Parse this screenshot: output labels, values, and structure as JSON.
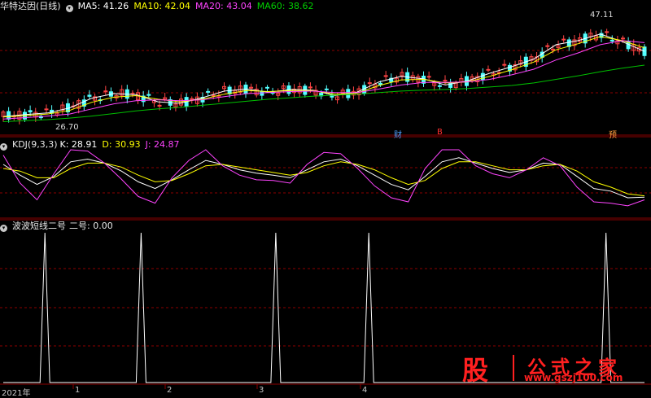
{
  "main_header": {
    "title": "华特达因(日线)",
    "ma5": "MA5: 41.26",
    "ma10": "MA10: 42.04",
    "ma20": "MA20: 43.04",
    "ma60": "MA60: 38.62"
  },
  "kdj_header": {
    "title": "KDJ(9,3,3)",
    "k": "K: 28.91",
    "d": "D: 30.93",
    "j": "J: 24.87"
  },
  "ind_header": {
    "title": "波波短线二号",
    "value": "二号: 0.00"
  },
  "price_labels": {
    "high": "47.11",
    "low": "26.70"
  },
  "event_marks": [
    "财",
    "B",
    "预"
  ],
  "x_labels": [
    "2021年",
    "1",
    "2",
    "3",
    "4"
  ],
  "logo": {
    "char": "股",
    "text": "公式之家",
    "url": "www.gszj100.com"
  },
  "colors": {
    "up": "#ff4444",
    "down": "#54ffff",
    "ma5": "#ffffff",
    "ma10": "#ffff00",
    "ma20": "#ff44ff",
    "ma60": "#00c000",
    "k": "#ffffff",
    "d": "#ffff00",
    "j": "#ff44ff",
    "grid": "#8b0000",
    "signal": "#ffffff"
  },
  "chart_data": [
    {
      "type": "line",
      "title": "华特达因(日线)",
      "note_series": [
        "MA5",
        "MA10",
        "MA20",
        "MA60"
      ],
      "series": [
        {
          "name": "MA5",
          "values": [
            28.5,
            28.9,
            29.2,
            30.2,
            32.1,
            33.0,
            32.8,
            31.4,
            31.1,
            32.2,
            33.5,
            33.9,
            33.3,
            33.8,
            33.7,
            32.6,
            33.3,
            35.3,
            36.4,
            35.9,
            34.7,
            35.5,
            37.0,
            38.3,
            39.8,
            42.6,
            43.4,
            44.7,
            43.2,
            41.3
          ]
        },
        {
          "name": "MA10",
          "values": [
            28.4,
            28.7,
            29.0,
            29.7,
            31.3,
            32.3,
            32.6,
            31.9,
            31.4,
            31.9,
            32.9,
            33.6,
            33.4,
            33.6,
            33.6,
            32.9,
            33.1,
            34.6,
            35.7,
            35.8,
            35.1,
            35.3,
            36.4,
            37.7,
            39.2,
            41.6,
            42.8,
            44.2,
            43.4,
            42.0
          ]
        },
        {
          "name": "MA20",
          "values": [
            28.0,
            28.3,
            28.6,
            29.0,
            30.0,
            31.0,
            31.6,
            31.8,
            31.6,
            31.8,
            32.4,
            33.0,
            33.2,
            33.4,
            33.5,
            33.2,
            33.2,
            33.9,
            34.7,
            35.2,
            35.2,
            35.3,
            35.8,
            36.7,
            37.8,
            39.6,
            41.0,
            42.6,
            43.4,
            43.0
          ]
        },
        {
          "name": "MA60",
          "values": [
            27.5,
            27.7,
            27.9,
            28.2,
            28.6,
            29.1,
            29.6,
            30.0,
            30.3,
            30.7,
            31.1,
            31.5,
            31.9,
            32.2,
            32.5,
            32.7,
            32.9,
            33.2,
            33.5,
            33.7,
            33.8,
            34.0,
            34.3,
            34.6,
            35.1,
            35.8,
            36.5,
            37.3,
            38.0,
            38.6
          ]
        }
      ],
      "annotations": [
        {
          "text": "47.11",
          "value": 47.11
        },
        {
          "text": "26.70",
          "value": 26.7
        }
      ],
      "ylim": [
        25.5,
        48.5
      ]
    },
    {
      "type": "line",
      "title": "KDJ(9,3,3)",
      "series": [
        {
          "name": "K",
          "values": [
            78,
            62,
            48,
            60,
            82,
            86,
            80,
            68,
            52,
            42,
            55,
            70,
            84,
            78,
            70,
            65,
            62,
            58,
            70,
            82,
            86,
            76,
            62,
            48,
            40,
            60,
            82,
            88,
            80,
            72,
            66,
            70,
            80,
            78,
            60,
            42,
            38,
            28,
            29
          ]
        },
        {
          "name": "D",
          "values": [
            72,
            68,
            58,
            58,
            72,
            80,
            80,
            74,
            62,
            52,
            54,
            64,
            76,
            78,
            74,
            70,
            66,
            62,
            66,
            76,
            82,
            78,
            70,
            58,
            48,
            54,
            72,
            82,
            82,
            76,
            70,
            70,
            76,
            78,
            68,
            52,
            44,
            34,
            31
          ]
        },
        {
          "name": "J",
          "values": [
            92,
            50,
            25,
            64,
            100,
            98,
            80,
            56,
            30,
            20,
            58,
            84,
            100,
            76,
            62,
            55,
            54,
            50,
            78,
            96,
            94,
            72,
            46,
            28,
            22,
            72,
            100,
            100,
            76,
            64,
            58,
            70,
            88,
            76,
            44,
            22,
            20,
            16,
            25
          ]
        }
      ],
      "ylim": [
        0,
        100
      ]
    },
    {
      "type": "line",
      "title": "波波短线二号",
      "series": [
        {
          "name": "二号",
          "spikes_at": [
            0.065,
            0.215,
            0.425,
            0.57,
            0.94
          ],
          "values": [
            0,
            1,
            0,
            1,
            0,
            1,
            0,
            1,
            0,
            1,
            0
          ]
        }
      ],
      "ylim": [
        0,
        1
      ]
    }
  ]
}
